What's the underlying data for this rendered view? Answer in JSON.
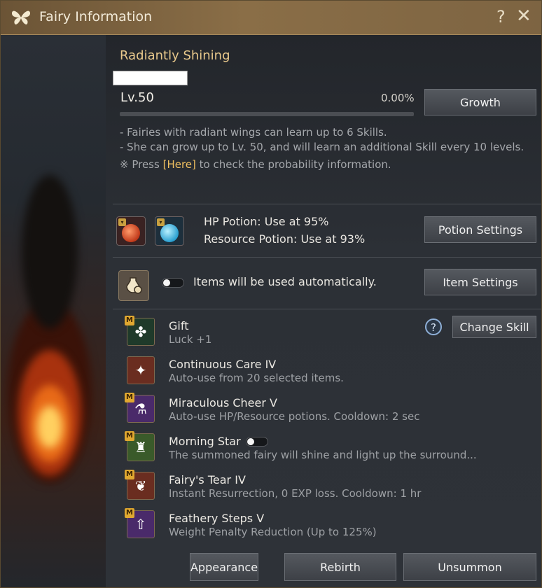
{
  "window": {
    "title": "Fairy Information"
  },
  "fairy": {
    "name": "Radiantly Shining",
    "level": "Lv.50",
    "exp_percent": "0.00%",
    "exp_fraction": 0.0
  },
  "buttons": {
    "growth": "Growth",
    "potion_settings": "Potion Settings",
    "item_settings": "Item Settings",
    "change_skill": "Change Skill",
    "appearance": "Appearance",
    "rebirth": "Rebirth",
    "unsummon": "Unsummon"
  },
  "info": {
    "line1": "- Fairies with radiant wings can learn up to 6 Skills.",
    "line2": "- She can grow up to Lv. 50, and will learn an additional Skill every 10 levels.",
    "line3_prefix": "※ Press ",
    "line3_link": "[Here]",
    "line3_suffix": " to check the probability information."
  },
  "potions": {
    "hp": "HP Potion: Use at 95%",
    "resource": "Resource Potion: Use at 93%",
    "hp_color": "#c0391a",
    "resource_color": "#2a9fd0"
  },
  "items": {
    "auto_text": "Items will be used automatically.",
    "auto_enabled": false
  },
  "skills": [
    {
      "name": "Gift",
      "desc": "Luck +1",
      "badge": "M",
      "icon": "clover-icon",
      "icon_bg": "#1f3a2a"
    },
    {
      "name": "Continuous Care IV",
      "desc": "Auto-use from 20 selected items.",
      "badge": "",
      "icon": "fairy-icon",
      "icon_bg": "#6a2d20"
    },
    {
      "name": "Miraculous Cheer V",
      "desc": "Auto-use HP/Resource potions. Cooldown: 2 sec",
      "badge": "M",
      "icon": "potion-icon",
      "icon_bg": "#4a2a6a"
    },
    {
      "name": "Morning Star",
      "desc": "The summoned fairy will shine and light up the surround...",
      "badge": "M",
      "icon": "lantern-icon",
      "icon_bg": "#3a5a2a"
    },
    {
      "name": "Fairy's Tear IV",
      "desc": "Instant Resurrection, 0 EXP loss. Cooldown: 1 hr",
      "badge": "M",
      "icon": "tear-icon",
      "icon_bg": "#6a2d20"
    },
    {
      "name": "Feathery Steps V",
      "desc": "Weight Penalty Reduction (Up to 125%)",
      "badge": "M",
      "icon": "weight-icon",
      "icon_bg": "#4a2a6a"
    }
  ],
  "help_glyph": "?",
  "close_glyph": "✕",
  "qmark_glyph": "?"
}
